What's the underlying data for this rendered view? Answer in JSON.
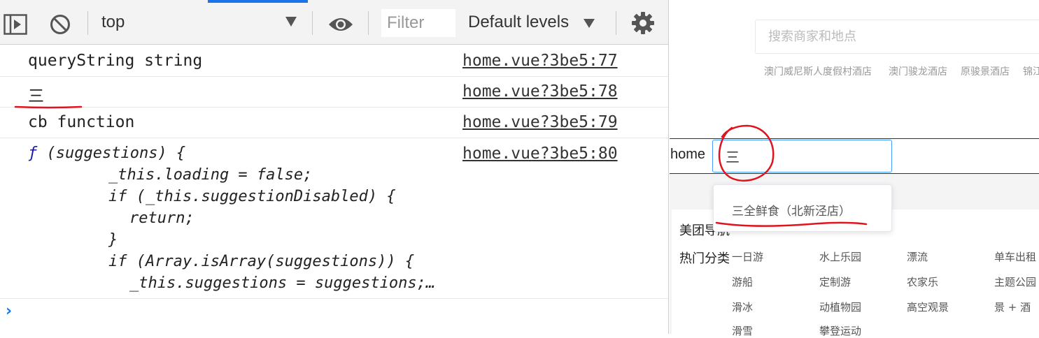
{
  "devtools": {
    "toolbar": {
      "context": "top",
      "filter_placeholder": "Filter",
      "levels": "Default levels"
    },
    "messages": [
      {
        "text": "queryString string",
        "source": "home.vue?3be5:77"
      },
      {
        "text": "三",
        "source": "home.vue?3be5:78"
      },
      {
        "text": "cb function",
        "source": "home.vue?3be5:79"
      },
      {
        "source": "home.vue?3be5:80"
      }
    ],
    "function_dump": {
      "f_symbol": "ƒ",
      "header": " (suggestions) {",
      "lines": [
        "_this.loading = false;",
        "if (_this.suggestionDisabled) {",
        "return;",
        "}",
        "if (Array.isArray(suggestions)) {",
        "_this.suggestions = suggestions;…"
      ]
    },
    "prompt": "›"
  },
  "page": {
    "search_placeholder": "搜索商家和地点",
    "hot_searches": [
      "澳门威尼斯人度假村酒店",
      "澳门骏龙酒店",
      "原骏景酒店",
      "锦江"
    ],
    "home_label": "home",
    "home_input_value": "三",
    "suggestion": "三全鲜食（北新泾店）",
    "nav_title": "美团导航",
    "hot_category_label": "热门分类",
    "categories": [
      [
        "一日游",
        "水上乐园",
        "漂流",
        "单车出租"
      ],
      [
        "游船",
        "定制游",
        "农家乐",
        "主题公园"
      ],
      [
        "滑冰",
        "动植物园",
        "高空观景",
        "景 + 酒"
      ],
      [
        "滑雪",
        "攀登运动"
      ]
    ]
  },
  "colors": {
    "accent": "#1a73e8",
    "annotation": "#e0141e",
    "input_focus": "#409eff"
  }
}
